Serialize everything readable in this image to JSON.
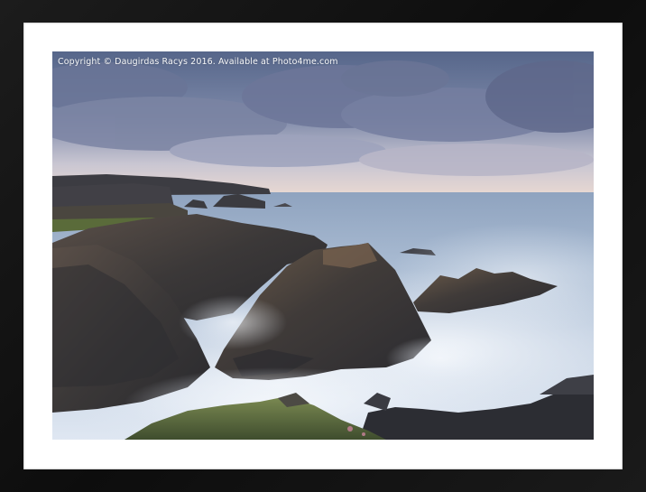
{
  "watermark": {
    "text": "Copyright  © Daugirdas Racys  2016. Available at Photo4me.com"
  },
  "colors": {
    "frame": "#141414",
    "mount": "#ffffff",
    "sky_top": "#5b6a88",
    "sky_horizon": "#e8dcd8",
    "sea": "#9fb3cc",
    "mist": "#eef2f8",
    "rock": "#3a3a3e",
    "grass": "#5a6b3a"
  }
}
